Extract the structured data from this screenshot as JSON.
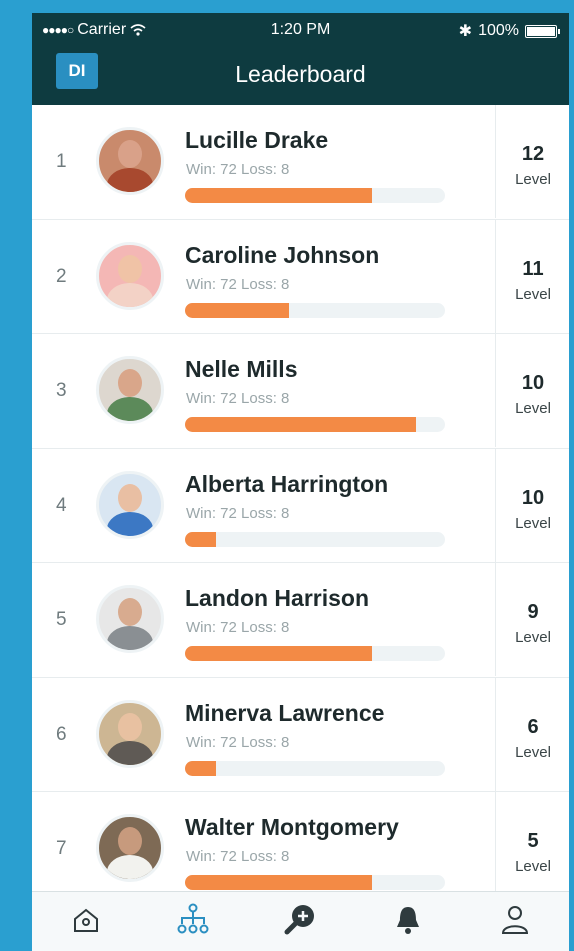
{
  "status": {
    "carrier": "Carrier",
    "time": "1:20 PM",
    "battery": "100%"
  },
  "header": {
    "logo": "DI",
    "title": "Leaderboard"
  },
  "level_label": "Level",
  "colors": {
    "header": "#0e3b40",
    "accent": "#f38a45",
    "logo_bg": "#2a8fc1",
    "active_tab": "#2a8fc1"
  },
  "players": [
    {
      "rank": "1",
      "name": "Lucille Drake",
      "stats": "Win: 72 Loss: 8",
      "progress": 0.72,
      "level": "12",
      "skin": "#d9a189",
      "shirt": "#a8492f",
      "bg": "#c98a6c"
    },
    {
      "rank": "2",
      "name": "Caroline Johnson",
      "stats": "Win: 72 Loss: 8",
      "progress": 0.4,
      "level": "11",
      "skin": "#f0c3a6",
      "shirt": "#f3d2c6",
      "bg": "#f4b7b5"
    },
    {
      "rank": "3",
      "name": "Nelle Mills",
      "stats": "Win: 72 Loss: 8",
      "progress": 0.89,
      "level": "10",
      "skin": "#d9a68a",
      "shirt": "#5c8a5a",
      "bg": "#ddd7cf"
    },
    {
      "rank": "4",
      "name": "Alberta Harrington",
      "stats": "Win: 72 Loss: 8",
      "progress": 0.12,
      "level": "10",
      "skin": "#e9bfa3",
      "shirt": "#3c78c4",
      "bg": "#d9e6f2"
    },
    {
      "rank": "5",
      "name": "Landon Harrison",
      "stats": "Win: 72 Loss: 8",
      "progress": 0.72,
      "level": "9",
      "skin": "#d8ab8f",
      "shirt": "#8a8f93",
      "bg": "#e7e7e7"
    },
    {
      "rank": "6",
      "name": "Minerva Lawrence",
      "stats": "Win: 72 Loss: 8",
      "progress": 0.12,
      "level": "6",
      "skin": "#e8c1a1",
      "shirt": "#5f5a55",
      "bg": "#cdb693"
    },
    {
      "rank": "7",
      "name": "Walter Montgomery",
      "stats": "Win: 72 Loss: 8",
      "progress": 0.72,
      "level": "5",
      "skin": "#c79a7d",
      "shirt": "#f2f2ee",
      "bg": "#7e6a55"
    }
  ],
  "tabs": [
    {
      "icon": "home-icon",
      "active": false
    },
    {
      "icon": "leaderboard-hierarchy-icon",
      "active": true
    },
    {
      "icon": "search-plus-icon",
      "active": false
    },
    {
      "icon": "bell-icon",
      "active": false
    },
    {
      "icon": "profile-icon",
      "active": false
    }
  ]
}
